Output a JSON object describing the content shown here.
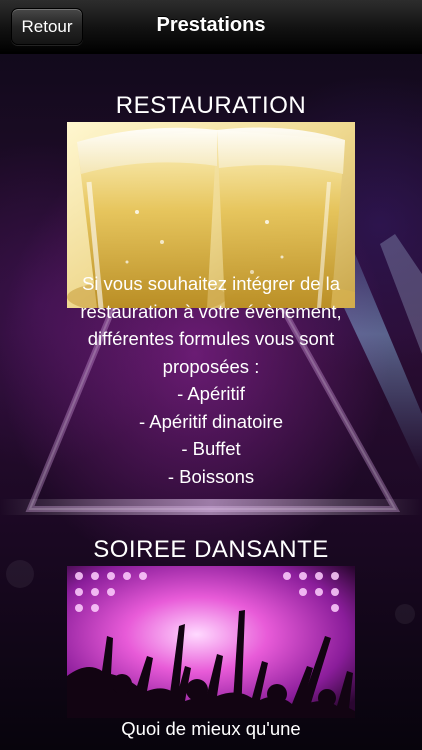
{
  "navbar": {
    "back_label": "Retour",
    "title": "Prestations"
  },
  "sections": [
    {
      "title": "RESTAURATION",
      "image_icon": "champagne-glasses-photo",
      "lines": [
        "Si vous souhaitez intégrer de la",
        "restauration à votre évènement,",
        "différentes formules vous sont",
        "proposées :",
        "- Apéritif",
        "- Apéritif dinatoire",
        "- Buffet",
        "- Boissons"
      ]
    },
    {
      "title": "SOIREE DANSANTE",
      "image_icon": "dancing-crowd-photo",
      "lines": [
        "Quoi de mieux qu'une"
      ]
    }
  ],
  "colors": {
    "navbar_top": "#2d2d2d",
    "navbar_bottom": "#000000",
    "background": "#2a0d33",
    "text": "#ffffff"
  }
}
